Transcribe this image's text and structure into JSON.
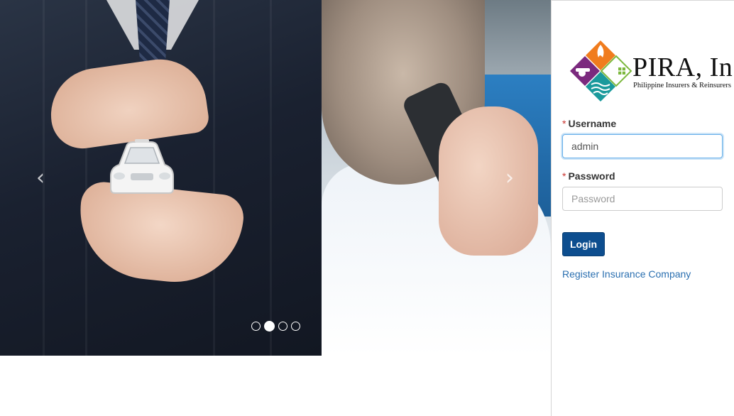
{
  "carousel": {
    "prev_icon": "chevron-left-icon",
    "next_icon": "chevron-right-icon",
    "prev_glyph": "‹",
    "next_glyph": "›",
    "slides_count": 4,
    "active_index": 1
  },
  "logo": {
    "name": "PIRA, In",
    "subtitle": "Philippine Insurers & Reinsurers",
    "colors": {
      "orange": "#f07c1e",
      "purple": "#7b2a7e",
      "teal": "#1a9a9c",
      "green": "#7cb83e"
    }
  },
  "login": {
    "username_label": "Username",
    "username_value": "admin",
    "password_label": "Password",
    "password_placeholder": "Password",
    "required_marker": "*",
    "login_button": "Login",
    "register_link": "Register Insurance Company"
  },
  "colors": {
    "primary": "#0d4e8f",
    "link": "#2a6fb0",
    "required": "#c9302c",
    "focus_border": "#66afe9"
  }
}
